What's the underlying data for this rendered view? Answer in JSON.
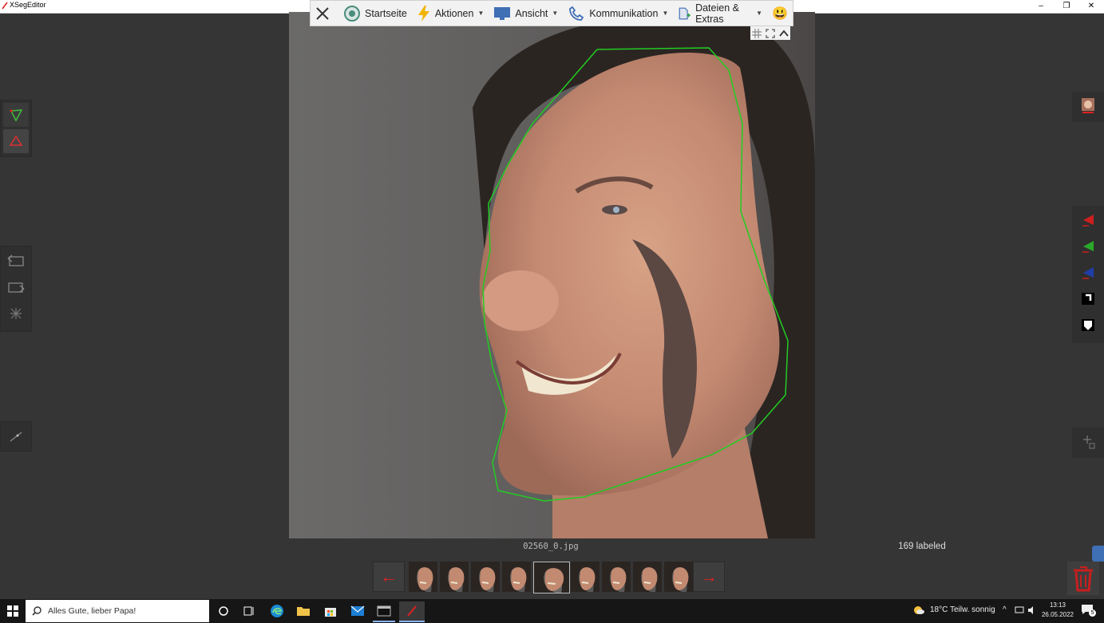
{
  "window": {
    "title": "XSegEditor",
    "minimize_glyph": "–",
    "maximize_glyph": "❐",
    "close_glyph": "✕"
  },
  "toolbar": {
    "items": [
      {
        "label": "Startseite",
        "icon": "home-circle-icon"
      },
      {
        "label": "Aktionen",
        "icon": "lightning-icon"
      },
      {
        "label": "Ansicht",
        "icon": "monitor-icon"
      },
      {
        "label": "Kommunikation",
        "icon": "phone-icon"
      },
      {
        "label": "Dateien & Extras",
        "icon": "file-plus-icon"
      }
    ],
    "emoji": "😃"
  },
  "editor": {
    "filename": "02560_0.jpg",
    "labeled_count": "169 labeled"
  },
  "left_tools": [
    "polygon-include-icon",
    "polygon-exclude-icon",
    "undo-point-icon",
    "redo-point-icon",
    "delete-poly-icon",
    "view-lines-icon"
  ],
  "right_tools": [
    "face-preview-icon",
    "red-mask-icon",
    "green-mask-icon",
    "blue-mask-icon",
    "black-mask-icon",
    "white-mask-icon",
    "add-poly-icon"
  ],
  "filmstrip": {
    "prev_glyph": "←",
    "next_glyph": "→",
    "thumb_count": 9,
    "selected_index": 4
  },
  "taskbar": {
    "search_placeholder": "Alles Gute, lieber Papa!",
    "weather": "18°C  Teilw. sonnig",
    "time": "13:13",
    "date": "26.05.2022",
    "notification_count": "5"
  },
  "colors": {
    "mask_outline": "#22cc22",
    "accent_red": "#e02020"
  }
}
